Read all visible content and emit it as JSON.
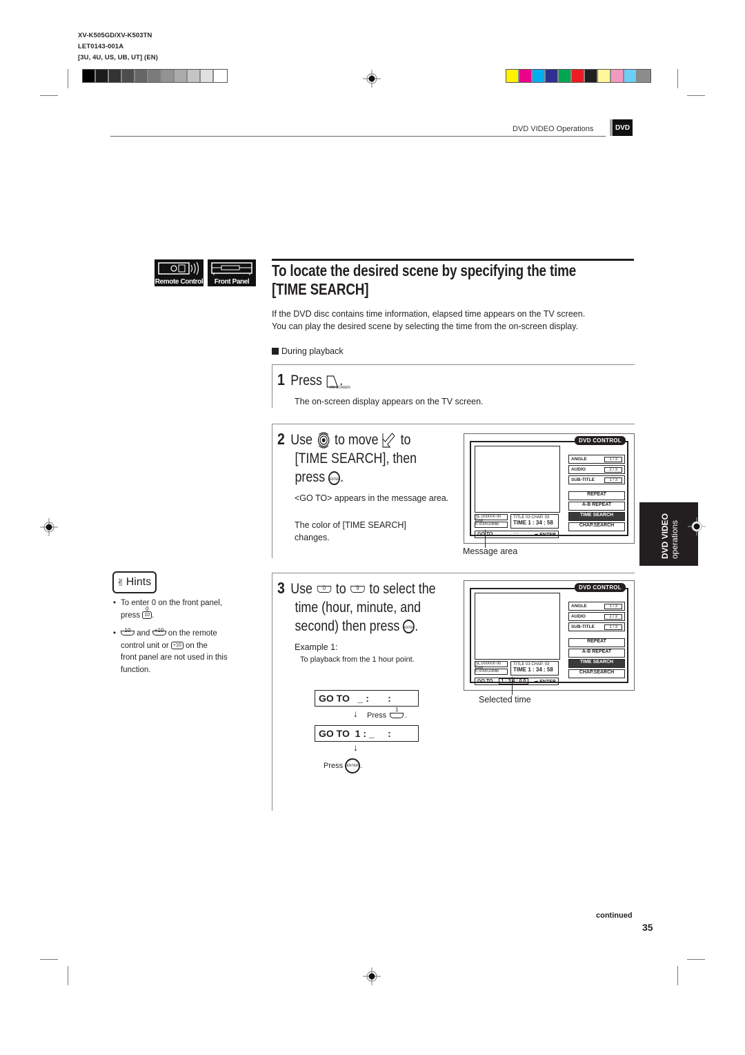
{
  "print_meta": {
    "model": "XV-K505GD/XV-K503TN",
    "doc_code": "LET0143-001A",
    "regions": "[3U, 4U, US, UB, UT]   (EN)"
  },
  "color_bars": {
    "grayscale": [
      "#000000",
      "#1c1c1c",
      "#333333",
      "#4d4d4d",
      "#666666",
      "#7a7a7a",
      "#939393",
      "#ababab",
      "#c4c4c4",
      "#e0e0e0",
      "#ffffff"
    ],
    "colors": [
      "#fff200",
      "#ec008c",
      "#00aeef",
      "#2e3192",
      "#00a651",
      "#ed1c24",
      "#231f20",
      "#fff799",
      "#f49ac1",
      "#6dcff6",
      "#8c8c8c"
    ]
  },
  "header": {
    "section": "DVD VIDEO Operations",
    "badge": "DVD"
  },
  "mode_icons": {
    "remote": "Remote Control",
    "front": "Front Panel"
  },
  "title": {
    "line1": "To locate the desired scene by specifying the time",
    "line2": "[TIME SEARCH]"
  },
  "intro": {
    "line1": "If the DVD disc contains time information, elapsed time appears on the TV screen.",
    "line2": "You can play the desired scene by selecting the time from the on-screen display.",
    "condition": "During playback"
  },
  "steps": [
    {
      "number": "1",
      "head": [
        "Press",
        "."
      ],
      "button_caption": "ON SCREEN",
      "desc": "The on-screen display appears on the TV screen."
    },
    {
      "number": "2",
      "head_line1": [
        "Use",
        "to move",
        "to"
      ],
      "head_line2": "[TIME SEARCH],  then",
      "head_line3": [
        "press",
        "."
      ],
      "enter_label": "ENTER",
      "desc1": "<GO TO> appears in the message area.",
      "desc2": "The color of [TIME SEARCH] changes.",
      "caption": "Message area"
    },
    {
      "number": "3",
      "head_line1": [
        "Use",
        "to",
        "to select the"
      ],
      "key_from": "0",
      "key_to": "9",
      "head_line2": "time (hour, minute, and",
      "head_line3": [
        "second) then press",
        "."
      ],
      "enter_label": "ENTER",
      "example_title": "Example 1:",
      "example_desc": "To playback from the 1 hour point.",
      "goto_before": "GO TO   _ :       :",
      "press_1": [
        "Press",
        "."
      ],
      "key_1": "1",
      "goto_after": "GO TO  1 : _     :",
      "press_enter": [
        "Press",
        "."
      ],
      "caption": "Selected time"
    }
  ],
  "osd": {
    "title": "DVD CONTROL",
    "rows": [
      {
        "label": "ANGLE",
        "value": "1 / 3"
      },
      {
        "label": "AUDIO",
        "value": "2 / 3"
      },
      {
        "label": "SUB-TITLE",
        "value": "1 / 3"
      }
    ],
    "buttons": [
      "REPEAT",
      "A-B REPEAT",
      "TIME SEARCH",
      "CHAP.SEARCH"
    ],
    "selected": "TIME SEARCH",
    "status_bar1": "SL.000000  00 End",
    "status_bar2": "0  000010MB",
    "title_chap": "TITLE 03   CHAP. 03",
    "time": "TIME  1 : 34 : 58",
    "msg_step2": {
      "goto": "GO TO",
      "field": "_  :      :",
      "enter": "➡ ENTER"
    },
    "msg_step3": {
      "goto": "GO TO",
      "field": "1 : 3 4 : 0 0",
      "enter": "➡ ENTER"
    }
  },
  "hints": {
    "logo": "Hints",
    "item1": [
      "To enter 0 on the front panel,",
      "press",
      "."
    ],
    "item1_key_top": "0",
    "item1_key": "10",
    "item2": [
      "and",
      "on the remote",
      "control unit or",
      "on the",
      "front panel are not used in this",
      "function."
    ],
    "item2_key_a": "10",
    "item2_key_b": "+10",
    "item2_key_c": "+10"
  },
  "side_tab": {
    "line1": "DVD VIDEO",
    "line2": "operations"
  },
  "footer": {
    "continued": "continued",
    "page_number": "35"
  }
}
